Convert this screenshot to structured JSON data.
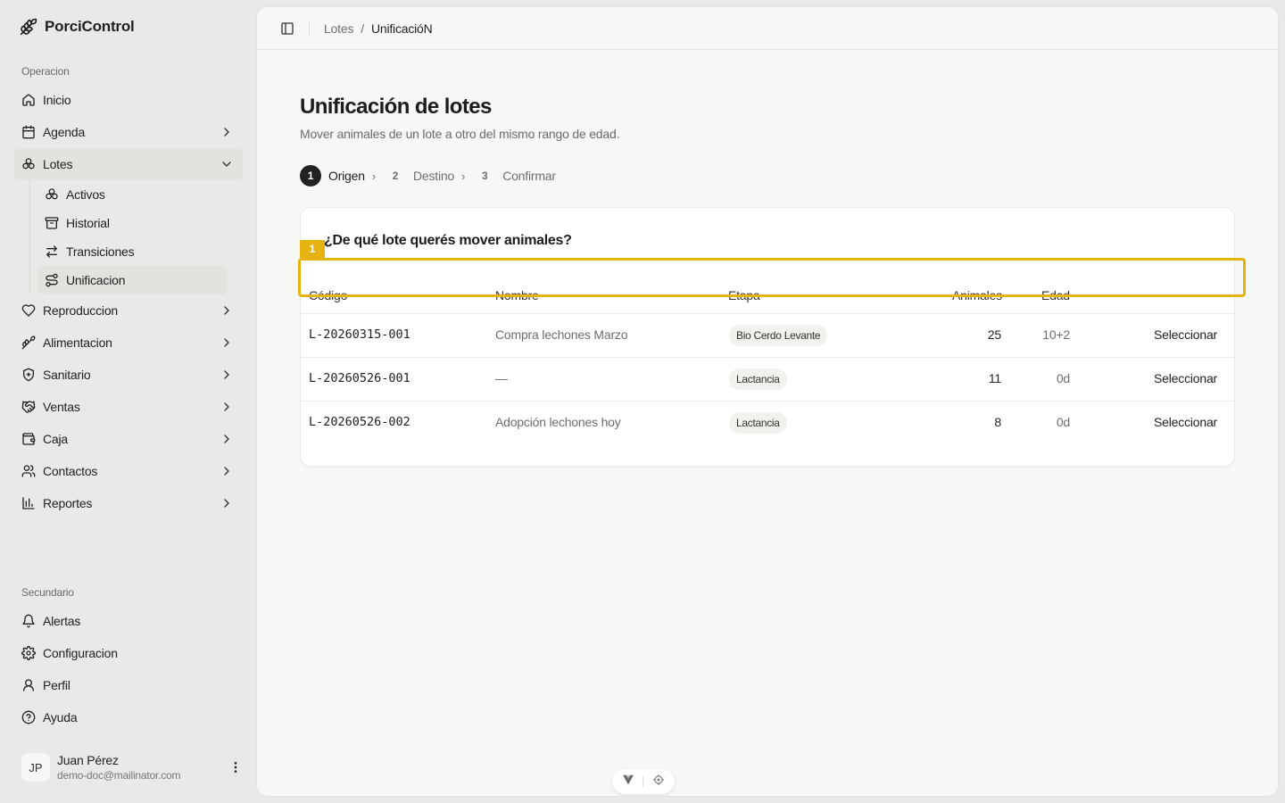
{
  "app": {
    "brand": "PorciControl"
  },
  "sidebar": {
    "section_main": "Operacion",
    "items": [
      {
        "label": "Inicio",
        "icon": "home-icon"
      },
      {
        "label": "Agenda",
        "icon": "calendar-icon"
      },
      {
        "label": "Lotes",
        "icon": "lotes-icon"
      },
      {
        "label": "Reproduccion",
        "icon": "heart-icon"
      },
      {
        "label": "Alimentacion",
        "icon": "wheat-icon"
      },
      {
        "label": "Sanitario",
        "icon": "shield-icon"
      },
      {
        "label": "Ventas",
        "icon": "handshake-icon"
      },
      {
        "label": "Caja",
        "icon": "wallet-icon"
      },
      {
        "label": "Contactos",
        "icon": "users-icon"
      },
      {
        "label": "Reportes",
        "icon": "chart-icon"
      }
    ],
    "lotes_sub": [
      {
        "label": "Activos"
      },
      {
        "label": "Historial"
      },
      {
        "label": "Transiciones"
      },
      {
        "label": "Unificacion"
      }
    ],
    "section_secondary": "Secundario",
    "secondary_items": [
      {
        "label": "Alertas"
      },
      {
        "label": "Configuracion"
      },
      {
        "label": "Perfil"
      },
      {
        "label": "Ayuda"
      }
    ],
    "user": {
      "initials": "JP",
      "name": "Juan Pérez",
      "email": "demo-doc@mailinator.com"
    }
  },
  "breadcrumb": {
    "parent": "Lotes",
    "separator": "/",
    "current": "UnificacióN"
  },
  "page": {
    "title": "Unificación de lotes",
    "subtitle": "Mover animales de un lote a otro del mismo rango de edad."
  },
  "steps": [
    {
      "num": "1",
      "label": "Origen"
    },
    {
      "num": "2",
      "label": "Destino"
    },
    {
      "num": "3",
      "label": "Confirmar"
    }
  ],
  "step_sep": "›",
  "card": {
    "title": "¿De qué lote querés mover animales?",
    "columns": {
      "code": "Código",
      "name": "Nombre",
      "stage": "Etapa",
      "animals": "Animales",
      "age": "Edad"
    },
    "rows": [
      {
        "code": "L-20260315-001",
        "name": "Compra lechones Marzo",
        "stage": "Bio Cerdo Levante",
        "animals": "25",
        "age": "10+2",
        "action": "Seleccionar"
      },
      {
        "code": "L-20260526-001",
        "name": "—",
        "stage": "Lactancia",
        "animals": "11",
        "age": "0d",
        "action": "Seleccionar"
      },
      {
        "code": "L-20260526-002",
        "name": "Adopción lechones hoy",
        "stage": "Lactancia",
        "animals": "8",
        "age": "0d",
        "action": "Seleccionar"
      }
    ]
  },
  "highlight": {
    "tag": "1",
    "color": "#e5b30f"
  }
}
